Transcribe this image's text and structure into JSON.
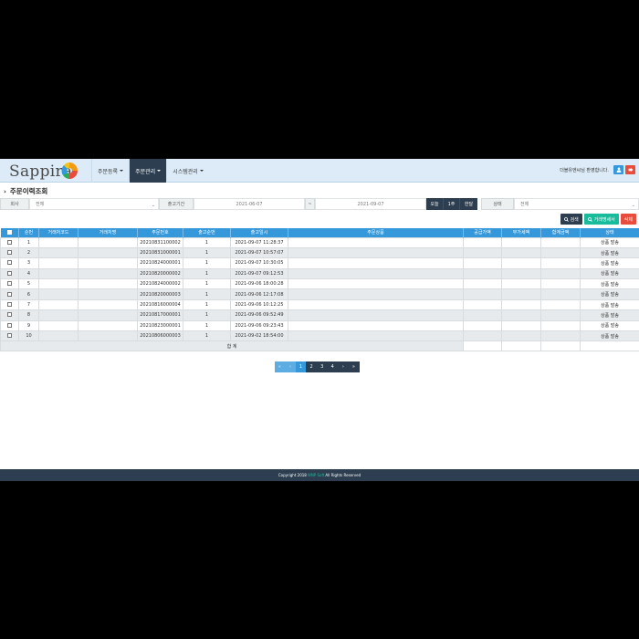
{
  "logo": {
    "text": "Sappira"
  },
  "nav": {
    "items": [
      {
        "label": "주문등록",
        "active": false
      },
      {
        "label": "주문관리",
        "active": true
      },
      {
        "label": "시스템관리",
        "active": false
      }
    ]
  },
  "user": {
    "greeting": "더블유엔씨님 환영합니다."
  },
  "page": {
    "title": "주문이력조회"
  },
  "filter": {
    "company_label": "회사",
    "company_value": "전체",
    "period_label": "출고기간",
    "date_from": "2021-06-07",
    "date_sep": "~",
    "date_to": "2021-09-07",
    "btn_today": "오늘",
    "btn_week": "1주",
    "btn_month": "한달",
    "status_label": "상태",
    "status_value": "전체"
  },
  "actions": {
    "search": "검색",
    "statement": "거래명세서",
    "delete": "삭제"
  },
  "table": {
    "headers": [
      "순번",
      "거래처코드",
      "거래처명",
      "주문번호",
      "출고순번",
      "출고일시",
      "주문상품",
      "공급가액",
      "부가세액",
      "합계금액",
      "상태"
    ],
    "rows": [
      {
        "no": "1",
        "order_no": "20210831100002",
        "seq": "1",
        "date": "2021-09-07 11:28:37",
        "status": "상품 발송"
      },
      {
        "no": "2",
        "order_no": "20210831000001",
        "seq": "1",
        "date": "2021-09-07 10:57:07",
        "status": "상품 발송"
      },
      {
        "no": "3",
        "order_no": "20210824000001",
        "seq": "1",
        "date": "2021-09-07 10:30:05",
        "status": "상품 발송"
      },
      {
        "no": "4",
        "order_no": "20210820000002",
        "seq": "1",
        "date": "2021-09-07 09:12:53",
        "status": "상품 발송"
      },
      {
        "no": "5",
        "order_no": "20210824000002",
        "seq": "1",
        "date": "2021-09-06 18:00:28",
        "status": "상품 발송"
      },
      {
        "no": "6",
        "order_no": "20210820000003",
        "seq": "1",
        "date": "2021-09-06 12:17:08",
        "status": "상품 발송"
      },
      {
        "no": "7",
        "order_no": "20210816000004",
        "seq": "1",
        "date": "2021-09-06 10:12:25",
        "status": "상품 발송"
      },
      {
        "no": "8",
        "order_no": "20210817000001",
        "seq": "1",
        "date": "2021-09-06 09:52:49",
        "status": "상품 발송"
      },
      {
        "no": "9",
        "order_no": "20210823000001",
        "seq": "1",
        "date": "2021-09-06 09:23:43",
        "status": "상품 발송"
      },
      {
        "no": "10",
        "order_no": "20210806000003",
        "seq": "1",
        "date": "2021-09-02 18:54:00",
        "status": "상품 발송"
      }
    ],
    "total_label": "합 계"
  },
  "pagination": {
    "first": "«",
    "prev": "‹",
    "pages": [
      "1",
      "2",
      "3",
      "4"
    ],
    "next": "›",
    "last": "»",
    "current": "1"
  },
  "footer": {
    "prefix": "Copyright 2018",
    "brand": "WNP Soft",
    "suffix": "All Rights Reserved"
  },
  "colors": {
    "navbar": "#dcebf7",
    "dark": "#2c3e50",
    "primary": "#3498db",
    "success": "#18bc9c",
    "danger": "#e74c3c"
  },
  "icons": {
    "user": "user-icon",
    "logout": "logout-icon",
    "search": "search-icon"
  }
}
